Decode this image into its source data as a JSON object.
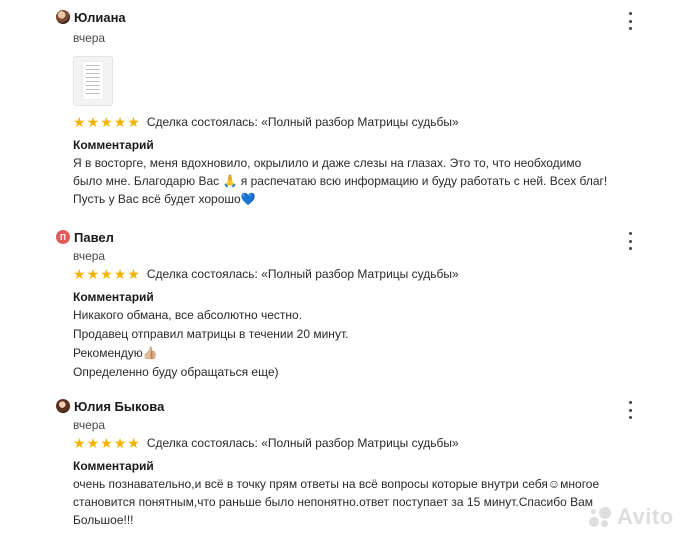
{
  "reviews": [
    {
      "author": "Юлиана",
      "date": "вчера",
      "has_photo": true,
      "stars": [
        "★",
        "★",
        "★",
        "★",
        "★"
      ],
      "deal": "Сделка состоялась: «Полный разбор Матрицы судьбы»",
      "comment_label": "Комментарий",
      "comment_lines": [
        "Я в восторге, меня вдохновило, окрылило и даже слезы на глазах. Это то, что необходимо",
        "было мне. Благодарю Вас 🙏 я распечатаю всю информацию и буду работать с ней. Всех благ!",
        "Пусть у Вас всё будет хорошо💙"
      ]
    },
    {
      "author": "Павел",
      "avatar_letter": "П",
      "date": "вчера",
      "stars": [
        "★",
        "★",
        "★",
        "★",
        "★"
      ],
      "deal": "Сделка состоялась: «Полный разбор Матрицы судьбы»",
      "comment_label": "Комментарий",
      "comment_lines": [
        "Никакого обмана, все абсолютно честно.",
        "Продавец отправил матрицы в течении 20 минут.",
        "Рекомендую👍🏼",
        "Определенно буду обращаться еще)"
      ]
    },
    {
      "author": "Юлия Быкова",
      "date": "вчера",
      "stars": [
        "★",
        "★",
        "★",
        "★",
        "★"
      ],
      "deal": "Сделка состоялась: «Полный разбор Матрицы судьбы»",
      "comment_label": "Комментарий",
      "comment_lines": [
        "очень познавательно,и всё в точку прям ответы на всё вопросы которые внутри себя☺многое",
        "становится понятным,что раньше было непонятно.ответ поступает за 15 минут.Спасибо Вам",
        "Большое!!!"
      ]
    }
  ],
  "watermark": "Avito",
  "colors": {
    "star": "#f5b300",
    "avatar_letter_bg": "#e25b5b"
  }
}
